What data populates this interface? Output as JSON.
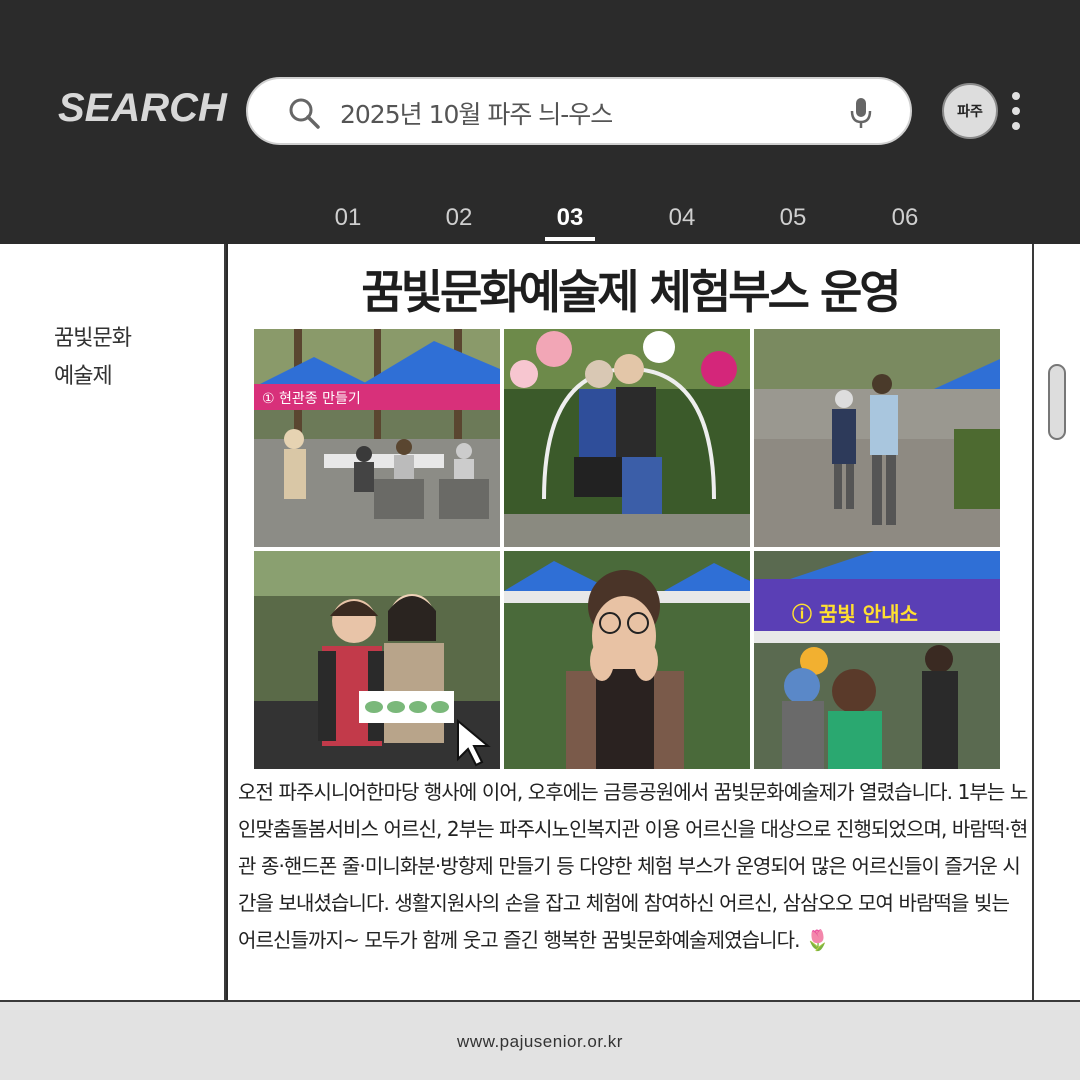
{
  "header": {
    "brand": "SEARCH",
    "search": {
      "value": "2025년 10월 파주 늬-우스"
    },
    "avatar_label": "파주"
  },
  "tabs": [
    {
      "label": "01"
    },
    {
      "label": "02"
    },
    {
      "label": "03",
      "active": true
    },
    {
      "label": "04"
    },
    {
      "label": "05"
    },
    {
      "label": "06"
    }
  ],
  "sidebar": {
    "category": "꿈빛문화\n예술제"
  },
  "article": {
    "title": "꿈빛문화예술제 체험부스 운영",
    "photos": [
      {
        "sign": "① 현관종 만들기"
      },
      {
        "sign": ""
      },
      {
        "sign": ""
      },
      {
        "sign": ""
      },
      {
        "sign": ""
      },
      {
        "sign": "ⓘ 꿈빛 안내소"
      }
    ],
    "body": "오전 파주시니어한마당 행사에 이어, 오후에는 금릉공원에서 꿈빛문화예술제가 열렸습니다. 1부는 노인맞춤돌봄서비스 어르신, 2부는 파주시노인복지관 이용 어르신을 대상으로 진행되었으며, 바람떡·현관 종·핸드폰 줄·미니화분·방향제 만들기 등 다양한 체험 부스가 운영되어 많은 어르신들이 즐거운 시간을 보내셨습니다. 생활지원사의 손을 잡고 체험에 참여하신 어르신, 삼삼오오 모여 바람떡을 빚는 어르신들까지~ 모두가 함께 웃고 즐긴 행복한 꿈빛문화예술제였습니다. 🌷"
  },
  "footer": {
    "url": "www.pajusenior.or.kr"
  },
  "colors": {
    "header_bg": "#2b2b2b",
    "panel_bg": "#ffffff",
    "footer_bg": "#e2e2e2",
    "tent_blue": "#2f6fd6",
    "banner_purple": "#5a3fb5"
  }
}
